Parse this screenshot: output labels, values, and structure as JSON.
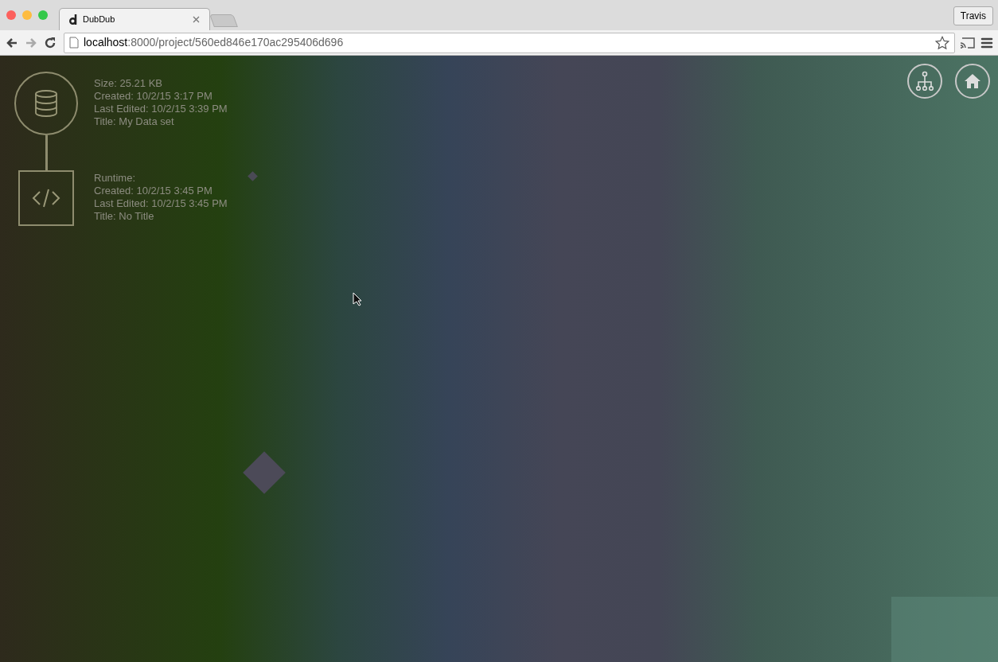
{
  "browser": {
    "tabs": [
      {
        "title": "DubDub",
        "selected": true
      }
    ],
    "profile": "Travis",
    "url_host": "localhost",
    "url_path": ":8000/project/560ed846e170ac295406d696"
  },
  "nodes": [
    {
      "kind": "database",
      "lines": [
        "Size: 25.21 KB",
        "Created: 10/2/15 3:17 PM",
        "Last Edited: 10/2/15 3:39 PM",
        "Title: My Data set"
      ]
    },
    {
      "kind": "code",
      "lines": [
        "Runtime:",
        "Created: 10/2/15 3:45 PM",
        "Last Edited: 10/2/15 3:45 PM",
        "Title: No Title"
      ]
    }
  ]
}
